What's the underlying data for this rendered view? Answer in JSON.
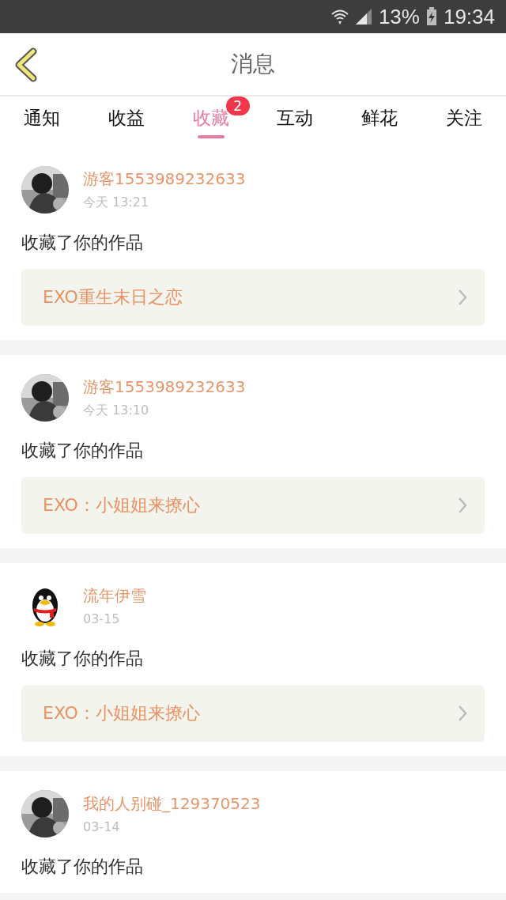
{
  "status_bar": {
    "battery": "13%",
    "time": "19:34"
  },
  "header": {
    "title": "消息"
  },
  "tabs": [
    {
      "label": "通知",
      "selected": false
    },
    {
      "label": "收益",
      "selected": false
    },
    {
      "label": "收藏",
      "selected": true,
      "badge": "2"
    },
    {
      "label": "互动",
      "selected": false
    },
    {
      "label": "鲜花",
      "selected": false
    },
    {
      "label": "关注",
      "selected": false
    }
  ],
  "messages": [
    {
      "name": "游客1553989232633",
      "time": "今天 13:21",
      "text": "收藏了你的作品",
      "work": "EXO重生末日之恋"
    },
    {
      "name": "游客1553989232633",
      "time": "今天 13:10",
      "text": "收藏了你的作品",
      "work": "EXO：小姐姐来撩心"
    },
    {
      "avatar": {
        "kind": "penguin"
      },
      "name": "流年伊雪",
      "time": "03-15",
      "text": "收藏了你的作品",
      "work": "EXO：小姐姐来撩心"
    },
    {
      "name": "我的人别碰_129370523",
      "time": "03-14",
      "text": "收藏了你的作品"
    }
  ]
}
